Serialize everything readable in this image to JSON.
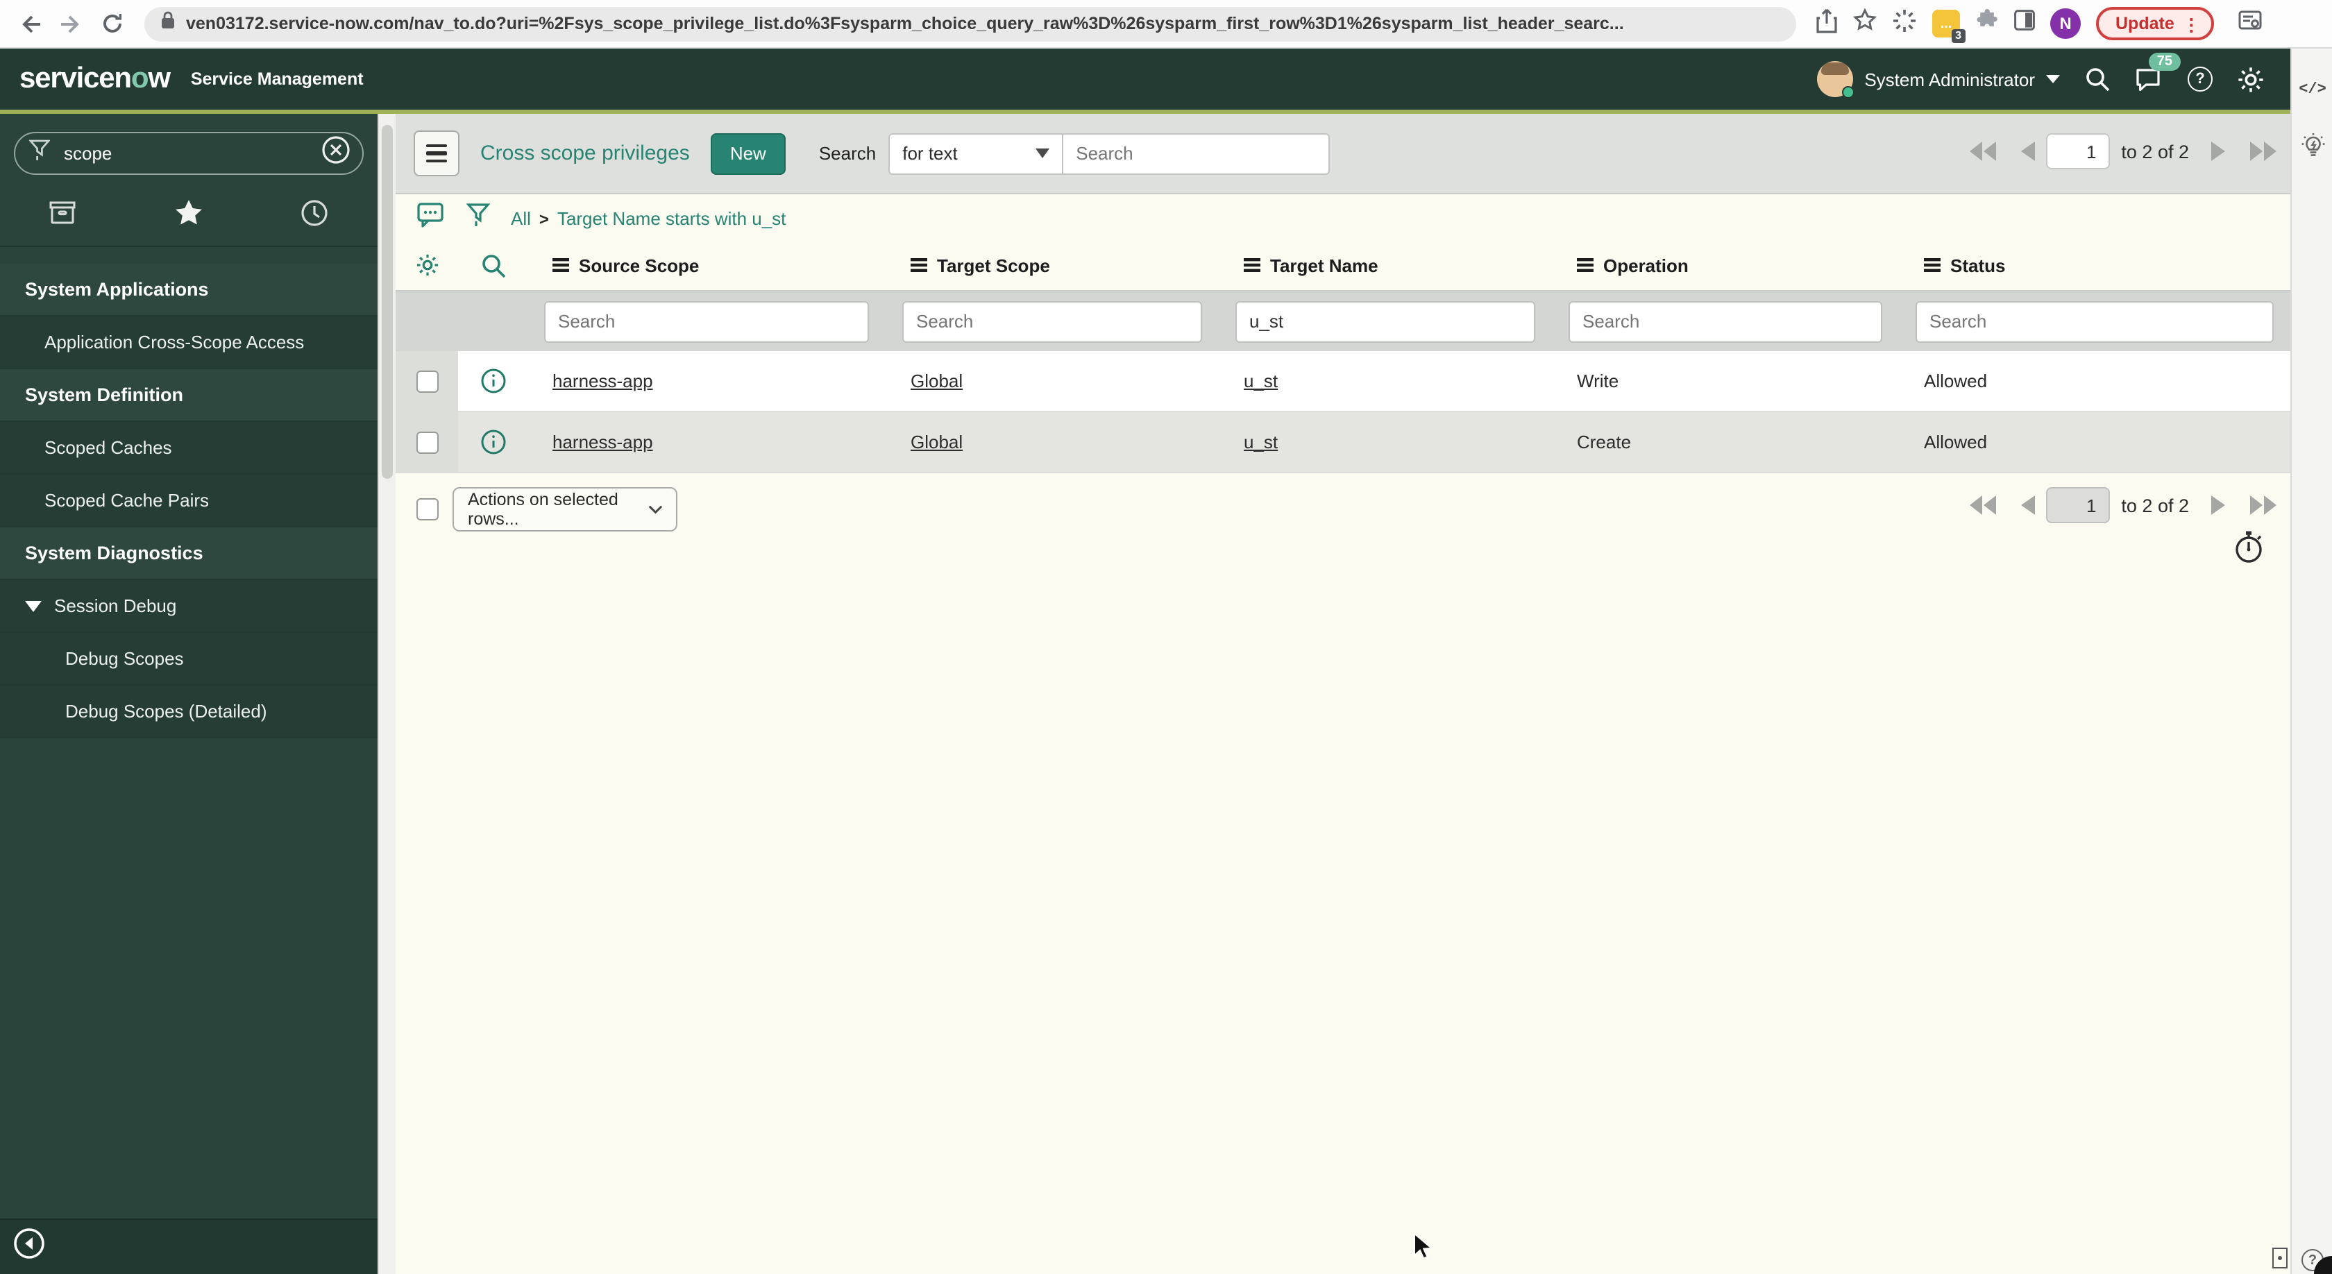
{
  "browser": {
    "url": "ven03172.service-now.com/nav_to.do?uri=%2Fsys_scope_privilege_list.do%3Fsysparm_choice_query_raw%3D%26sysparm_first_row%3D1%26sysparm_list_header_searc...",
    "update_label": "Update",
    "update_dots": "⋮",
    "profile_initial": "N",
    "extension_badge": "3",
    "extension_dots": "..."
  },
  "header": {
    "logo_pre": "servicen",
    "logo_o": "o",
    "logo_post": "w",
    "product": "Service Management",
    "user": "System Administrator",
    "notification_count": "75",
    "help_glyph": "?"
  },
  "rail": {
    "code_glyph": "</>",
    "help_glyph": "?"
  },
  "sidebar": {
    "filter_value": "scope",
    "items": [
      {
        "label": "System Applications",
        "type": "section"
      },
      {
        "label": "Application Cross-Scope Access",
        "type": "item"
      },
      {
        "label": "System Definition",
        "type": "section"
      },
      {
        "label": "Scoped Caches",
        "type": "item"
      },
      {
        "label": "Scoped Cache Pairs",
        "type": "item"
      },
      {
        "label": "System Diagnostics",
        "type": "section"
      },
      {
        "label": "Session Debug",
        "type": "expandable"
      },
      {
        "label": "Debug Scopes",
        "type": "subitem"
      },
      {
        "label": "Debug Scopes (Detailed)",
        "type": "subitem"
      }
    ]
  },
  "toolbar": {
    "title": "Cross scope privileges",
    "new_label": "New",
    "search_label": "Search",
    "search_type": "for text",
    "search_placeholder": "Search"
  },
  "breadcrumb": {
    "root": "All",
    "separator": ">",
    "filter": "Target Name starts with u_st"
  },
  "table": {
    "columns": [
      "Source Scope",
      "Target Scope",
      "Target Name",
      "Operation",
      "Status"
    ],
    "filter_placeholder": "Search",
    "target_name_filter": "u_st",
    "rows": [
      {
        "source_scope": "harness-app",
        "target_scope": "Global",
        "target_name": "u_st",
        "operation": "Write",
        "status": "Allowed"
      },
      {
        "source_scope": "harness-app",
        "target_scope": "Global",
        "target_name": "u_st",
        "operation": "Create",
        "status": "Allowed"
      }
    ],
    "actions_placeholder": "Actions on selected rows..."
  },
  "pagination": {
    "page": "1",
    "range_label": "to 2 of 2"
  },
  "colors": {
    "accent_teal": "#278472",
    "header_green": "#243B33",
    "strip_green": "#9FB259",
    "badge_teal": "#6FBF9F",
    "update_red": "#D0403F"
  }
}
